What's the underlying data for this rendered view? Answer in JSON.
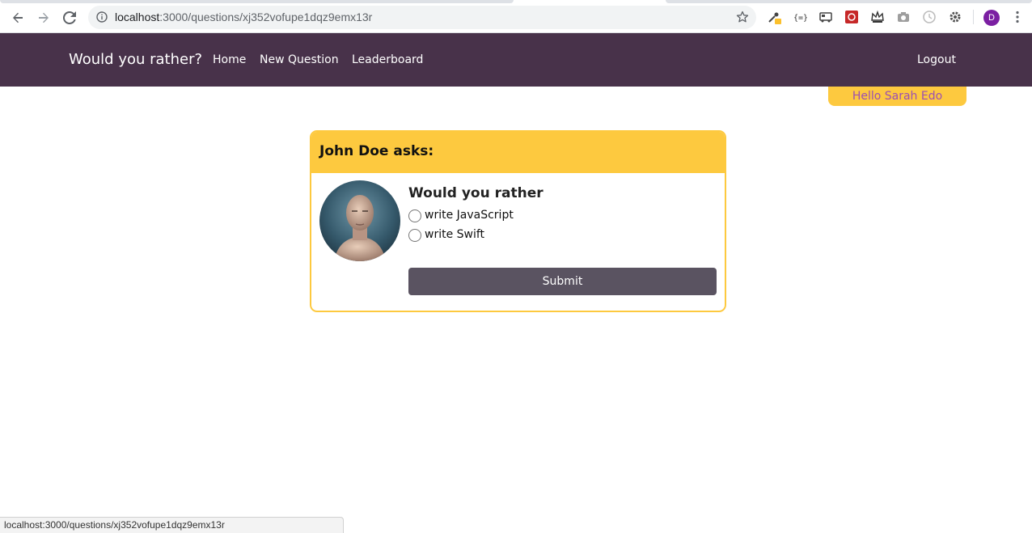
{
  "browser": {
    "url_host": "localhost",
    "url_rest": ":3000/questions/xj352vofupe1dqz9emx13r",
    "profile_initial": "D"
  },
  "app": {
    "brand": "Would you rather?",
    "nav": [
      "Home",
      "New Question",
      "Leaderboard"
    ],
    "logout": "Logout",
    "greeting": "Hello Sarah Edo"
  },
  "question": {
    "asker": "John Doe asks:",
    "title": "Would you rather",
    "options": [
      "write JavaScript",
      "write Swift"
    ],
    "submit": "Submit"
  },
  "status_url": "localhost:3000/questions/xj352vofupe1dqz9emx13r",
  "colors": {
    "navbar": "#48324a",
    "accent": "#fdc93f",
    "greeting_text": "#9b4fb3",
    "submit": "#5a5361"
  }
}
